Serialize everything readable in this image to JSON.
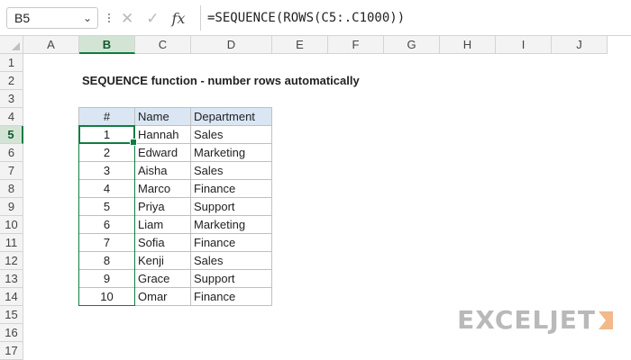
{
  "namebox": {
    "value": "B5"
  },
  "formula_bar": {
    "cancel_icon": "x-icon",
    "enter_icon": "check-icon",
    "fx_label": "fx",
    "formula": "=SEQUENCE(ROWS(C5:.C1000))"
  },
  "columns": [
    "A",
    "B",
    "C",
    "D",
    "E",
    "F",
    "G",
    "H",
    "I",
    "J"
  ],
  "rows": [
    "1",
    "2",
    "3",
    "4",
    "5",
    "6",
    "7",
    "8",
    "9",
    "10",
    "11",
    "12",
    "13",
    "14",
    "15",
    "16",
    "17"
  ],
  "selected_column": "B",
  "selected_row": "5",
  "sheet": {
    "title": "SEQUENCE function - number rows automatically",
    "headers": [
      "#",
      "Name",
      "Department"
    ],
    "records": [
      {
        "num": "1",
        "name": "Hannah",
        "dept": "Sales"
      },
      {
        "num": "2",
        "name": "Edward",
        "dept": "Marketing"
      },
      {
        "num": "3",
        "name": "Aisha",
        "dept": "Sales"
      },
      {
        "num": "4",
        "name": "Marco",
        "dept": "Finance"
      },
      {
        "num": "5",
        "name": "Priya",
        "dept": "Support"
      },
      {
        "num": "6",
        "name": "Liam",
        "dept": "Marketing"
      },
      {
        "num": "7",
        "name": "Sofia",
        "dept": "Finance"
      },
      {
        "num": "8",
        "name": "Kenji",
        "dept": "Sales"
      },
      {
        "num": "9",
        "name": "Grace",
        "dept": "Support"
      },
      {
        "num": "10",
        "name": "Omar",
        "dept": "Finance"
      }
    ]
  },
  "logo": {
    "text": "EXCELJET"
  },
  "colors": {
    "accent": "#107c41",
    "header_fill": "#dbe6f4"
  }
}
